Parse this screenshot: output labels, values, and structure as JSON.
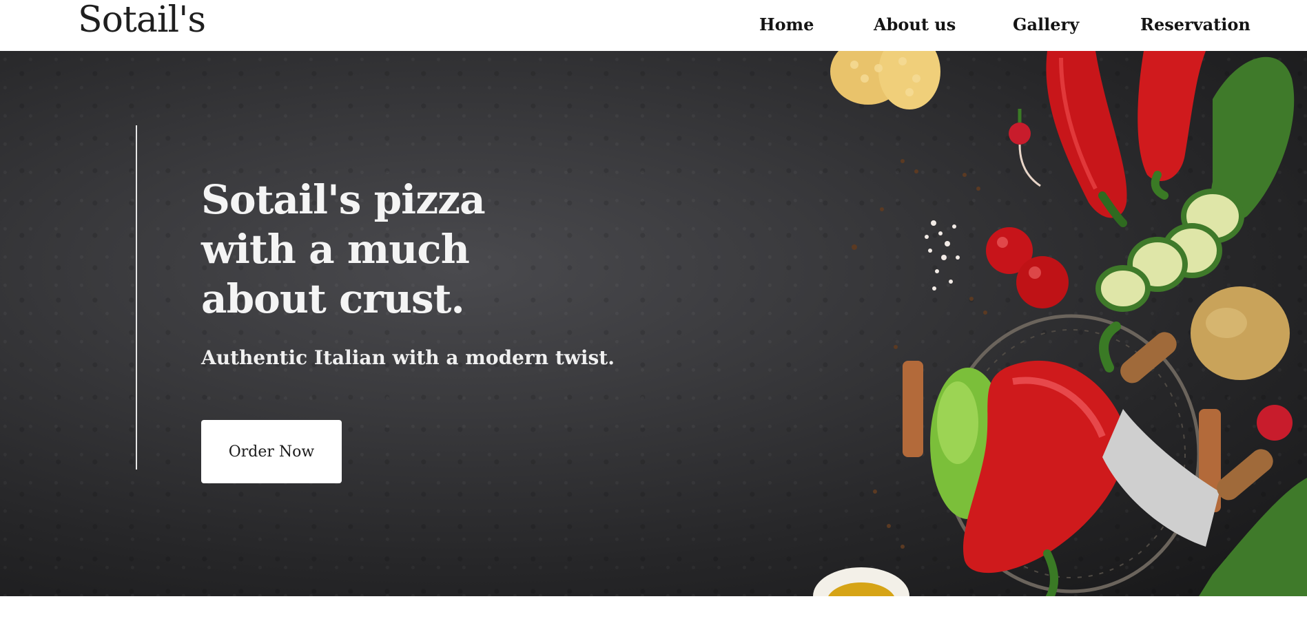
{
  "header": {
    "logo": "Sotail's",
    "nav": [
      "Home",
      "About us",
      "Gallery",
      "Reservation"
    ]
  },
  "hero": {
    "headline_lines": [
      "Sotail's pizza",
      "with a much",
      "about crust."
    ],
    "subtitle": "Authentic Italian with a modern twist.",
    "cta_label": "Order Now"
  },
  "colors": {
    "background_dark": "#2e2e30",
    "text_light": "#f4f4f4",
    "button_bg": "#ffffff",
    "pepper_red": "#d41a1e",
    "zucchini_green": "#3f7a2a"
  },
  "icons": [
    "vegetables-photo"
  ]
}
